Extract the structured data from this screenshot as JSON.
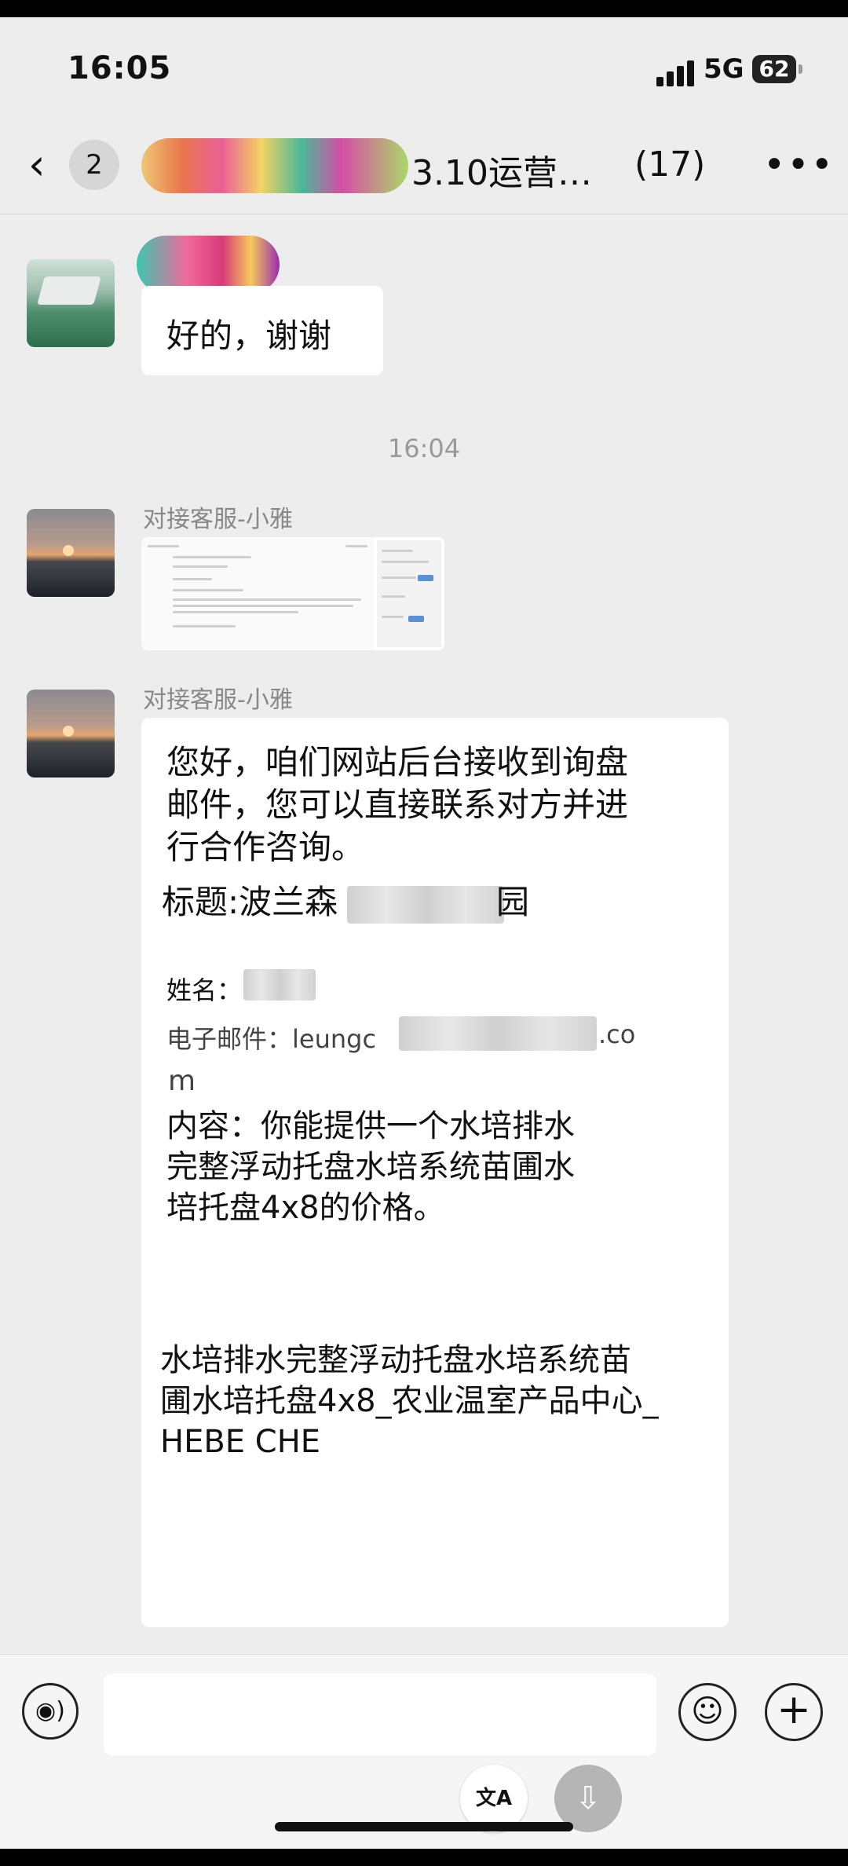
{
  "status_bar": {
    "time": "16:05",
    "network": "5G",
    "battery": "62"
  },
  "nav": {
    "unread_count": "2",
    "title": "3.10运营…",
    "member_count": "(17)"
  },
  "messages": {
    "first_reply": "好的，谢谢",
    "timestamp": "16:04",
    "sender": "对接客服-小雅",
    "body_lines": [
      "您好，咱们网站后台接收到询盘",
      "邮件，您可以直接联系对方并进",
      "行合作咨询。"
    ],
    "subject_label": "标题:波兰森",
    "subject_tail": "园",
    "name_label": "姓名：",
    "email_label": "电子邮件：leungc",
    "email_tail": ".co",
    "email_wrap": "m",
    "content_lines": [
      "内容：你能提供一个水培排水",
      "完整浮动托盘水培系统苗圃水",
      "培托盘4x8的价格。"
    ],
    "product_lines": [
      "水培排水完整浮动托盘水培系统苗",
      "圃水培托盘4x8_农业温室产品中心_",
      "HEBE CHE"
    ]
  },
  "input_bar": {
    "translate_label": "文A"
  },
  "icons": {
    "back": "chevron-left-icon",
    "more": "more-icon",
    "voice": "voice-icon",
    "emoji": "emoji-icon",
    "plus": "plus-icon",
    "translate": "translate-icon",
    "save": "download-icon"
  }
}
